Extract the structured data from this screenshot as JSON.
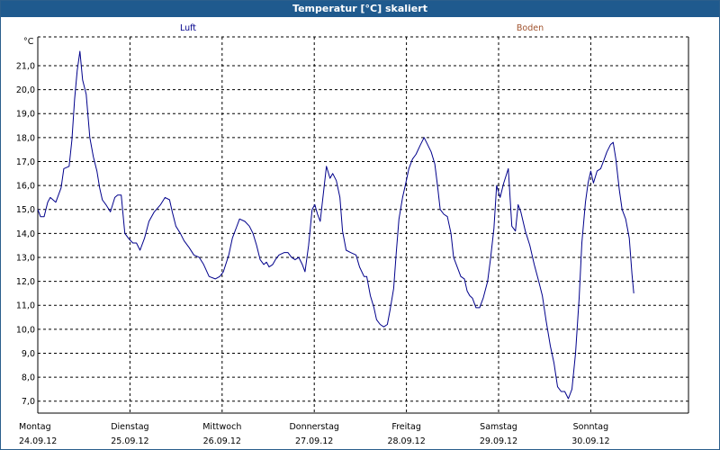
{
  "window": {
    "title": "Temperatur [°C] skaliert"
  },
  "colors": {
    "luft": "#00008b",
    "boden": "#a0522d",
    "titlebar": "#1f5a8e"
  },
  "chart_data": {
    "type": "line",
    "title": "Temperatur [°C] skaliert",
    "ylabel": "°C",
    "ylim": [
      6.5,
      22.2
    ],
    "y_ticks": [
      "7,0",
      "8,0",
      "9,0",
      "10,0",
      "11,0",
      "12,0",
      "13,0",
      "14,0",
      "15,0",
      "16,0",
      "17,0",
      "18,0",
      "19,0",
      "20,0",
      "21,0"
    ],
    "xlim": [
      0,
      7
    ],
    "x_ticks": [
      {
        "day": "Montag",
        "date": "24.09.12",
        "x": 0
      },
      {
        "day": "Dienstag",
        "date": "25.09.12",
        "x": 1
      },
      {
        "day": "Mittwoch",
        "date": "26.09.12",
        "x": 2
      },
      {
        "day": "Donnerstag",
        "date": "27.09.12",
        "x": 3
      },
      {
        "day": "Freitag",
        "date": "28.09.12",
        "x": 4
      },
      {
        "day": "Samstag",
        "date": "29.09.12",
        "x": 5
      },
      {
        "day": "Sonntag",
        "date": "30.09.12",
        "x": 6
      }
    ],
    "grid": true,
    "legend": [
      {
        "name": "Luft",
        "color": "#00008b"
      },
      {
        "name": "Boden",
        "color": "#a0522d"
      }
    ],
    "series": [
      {
        "name": "Luft",
        "color": "#00008b",
        "points": [
          [
            0.0,
            15.0
          ],
          [
            0.029,
            14.7
          ],
          [
            0.068,
            14.7
          ],
          [
            0.107,
            15.3
          ],
          [
            0.136,
            15.5
          ],
          [
            0.195,
            15.3
          ],
          [
            0.253,
            15.9
          ],
          [
            0.282,
            16.7
          ],
          [
            0.34,
            16.8
          ],
          [
            0.37,
            17.9
          ],
          [
            0.399,
            19.6
          ],
          [
            0.428,
            20.8
          ],
          [
            0.457,
            21.6
          ],
          [
            0.486,
            20.4
          ],
          [
            0.525,
            19.8
          ],
          [
            0.564,
            18.0
          ],
          [
            0.603,
            17.2
          ],
          [
            0.642,
            16.6
          ],
          [
            0.671,
            15.9
          ],
          [
            0.7,
            15.4
          ],
          [
            0.739,
            15.2
          ],
          [
            0.788,
            14.9
          ],
          [
            0.836,
            15.5
          ],
          [
            0.866,
            15.6
          ],
          [
            0.905,
            15.6
          ],
          [
            0.944,
            14.0
          ],
          [
            0.982,
            13.8
          ],
          [
            1.031,
            13.6
          ],
          [
            1.07,
            13.6
          ],
          [
            1.109,
            13.3
          ],
          [
            1.158,
            13.8
          ],
          [
            1.206,
            14.5
          ],
          [
            1.264,
            14.9
          ],
          [
            1.332,
            15.2
          ],
          [
            1.381,
            15.5
          ],
          [
            1.43,
            15.4
          ],
          [
            1.459,
            14.9
          ],
          [
            1.498,
            14.3
          ],
          [
            1.547,
            14.0
          ],
          [
            1.586,
            13.7
          ],
          [
            1.644,
            13.4
          ],
          [
            1.693,
            13.1
          ],
          [
            1.751,
            13.0
          ],
          [
            1.8,
            12.7
          ],
          [
            1.858,
            12.2
          ],
          [
            1.926,
            12.1
          ],
          [
            1.975,
            12.2
          ],
          [
            2.014,
            12.4
          ],
          [
            2.072,
            13.1
          ],
          [
            2.111,
            13.8
          ],
          [
            2.15,
            14.2
          ],
          [
            2.189,
            14.6
          ],
          [
            2.247,
            14.5
          ],
          [
            2.296,
            14.3
          ],
          [
            2.335,
            14.0
          ],
          [
            2.374,
            13.5
          ],
          [
            2.413,
            12.9
          ],
          [
            2.452,
            12.7
          ],
          [
            2.481,
            12.8
          ],
          [
            2.51,
            12.6
          ],
          [
            2.549,
            12.7
          ],
          [
            2.578,
            12.9
          ],
          [
            2.617,
            13.1
          ],
          [
            2.675,
            13.2
          ],
          [
            2.714,
            13.2
          ],
          [
            2.753,
            13.0
          ],
          [
            2.792,
            12.9
          ],
          [
            2.831,
            13.0
          ],
          [
            2.87,
            12.7
          ],
          [
            2.899,
            12.4
          ],
          [
            2.938,
            13.5
          ],
          [
            2.977,
            15.0
          ],
          [
            3.006,
            15.2
          ],
          [
            3.035,
            14.8
          ],
          [
            3.064,
            14.5
          ],
          [
            3.103,
            15.8
          ],
          [
            3.132,
            16.8
          ],
          [
            3.171,
            16.3
          ],
          [
            3.2,
            16.5
          ],
          [
            3.239,
            16.2
          ],
          [
            3.278,
            15.5
          ],
          [
            3.307,
            14.1
          ],
          [
            3.346,
            13.3
          ],
          [
            3.394,
            13.2
          ],
          [
            3.453,
            13.1
          ],
          [
            3.491,
            12.6
          ],
          [
            3.54,
            12.2
          ],
          [
            3.569,
            12.2
          ],
          [
            3.608,
            11.4
          ],
          [
            3.647,
            10.9
          ],
          [
            3.676,
            10.4
          ],
          [
            3.715,
            10.2
          ],
          [
            3.754,
            10.1
          ],
          [
            3.793,
            10.2
          ],
          [
            3.822,
            10.8
          ],
          [
            3.861,
            11.7
          ],
          [
            3.89,
            13.2
          ],
          [
            3.919,
            14.6
          ],
          [
            3.958,
            15.5
          ],
          [
            3.987,
            16.0
          ],
          [
            4.026,
            16.7
          ],
          [
            4.065,
            17.1
          ],
          [
            4.104,
            17.3
          ],
          [
            4.152,
            17.7
          ],
          [
            4.191,
            18.0
          ],
          [
            4.23,
            17.7
          ],
          [
            4.269,
            17.4
          ],
          [
            4.308,
            16.9
          ],
          [
            4.337,
            16.0
          ],
          [
            4.366,
            15.0
          ],
          [
            4.405,
            14.8
          ],
          [
            4.444,
            14.7
          ],
          [
            4.483,
            14.0
          ],
          [
            4.512,
            13.0
          ],
          [
            4.551,
            12.6
          ],
          [
            4.59,
            12.2
          ],
          [
            4.629,
            12.1
          ],
          [
            4.658,
            11.6
          ],
          [
            4.687,
            11.4
          ],
          [
            4.716,
            11.3
          ],
          [
            4.755,
            10.9
          ],
          [
            4.794,
            10.9
          ],
          [
            4.833,
            11.3
          ],
          [
            4.881,
            12.0
          ],
          [
            4.911,
            12.9
          ],
          [
            4.949,
            14.2
          ],
          [
            4.979,
            16.0
          ],
          [
            5.017,
            15.5
          ],
          [
            5.056,
            16.1
          ],
          [
            5.105,
            16.7
          ],
          [
            5.144,
            14.3
          ],
          [
            5.183,
            14.1
          ],
          [
            5.212,
            15.2
          ],
          [
            5.241,
            14.9
          ],
          [
            5.29,
            14.1
          ],
          [
            5.339,
            13.5
          ],
          [
            5.387,
            12.7
          ],
          [
            5.436,
            12.0
          ],
          [
            5.475,
            11.4
          ],
          [
            5.514,
            10.4
          ],
          [
            5.562,
            9.3
          ],
          [
            5.601,
            8.6
          ],
          [
            5.64,
            7.6
          ],
          [
            5.679,
            7.4
          ],
          [
            5.718,
            7.4
          ],
          [
            5.757,
            7.1
          ],
          [
            5.796,
            7.5
          ],
          [
            5.835,
            9.0
          ],
          [
            5.874,
            11.3
          ],
          [
            5.903,
            13.6
          ],
          [
            5.942,
            15.3
          ],
          [
            5.971,
            16.1
          ],
          [
            6.0,
            16.6
          ],
          [
            6.029,
            16.1
          ],
          [
            6.068,
            16.6
          ],
          [
            6.107,
            16.7
          ],
          [
            6.146,
            17.1
          ],
          [
            6.175,
            17.4
          ],
          [
            6.214,
            17.7
          ],
          [
            6.243,
            17.8
          ],
          [
            6.272,
            17.1
          ],
          [
            6.311,
            15.8
          ],
          [
            6.34,
            15.0
          ],
          [
            6.379,
            14.6
          ],
          [
            6.418,
            13.8
          ],
          [
            6.447,
            12.3
          ],
          [
            6.467,
            11.5
          ]
        ]
      },
      {
        "name": "Boden",
        "color": "#a0522d",
        "points": []
      }
    ]
  }
}
